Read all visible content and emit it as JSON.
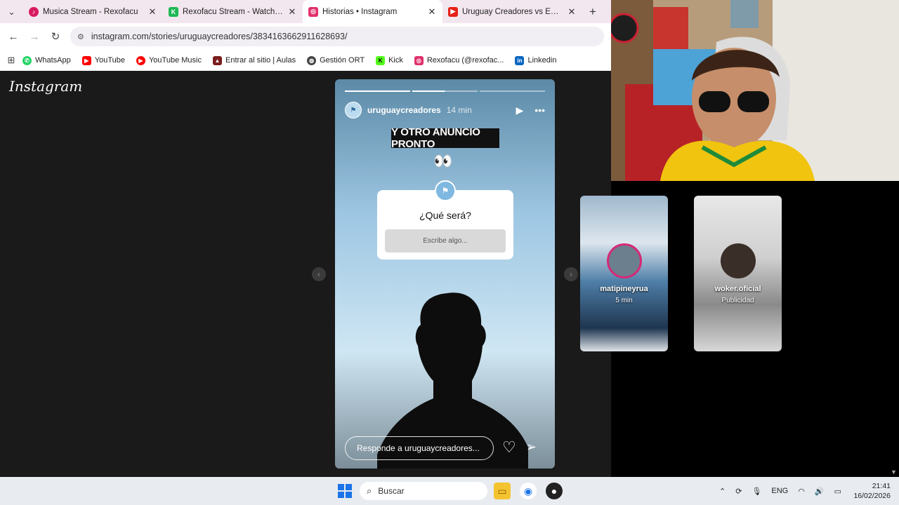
{
  "browser": {
    "tabs": [
      {
        "title": "Musica Stream - Rexofacu",
        "favicon_color": "#d81b60",
        "icon": "music-icon"
      },
      {
        "title": "Rexofacu Stream - Watch Live on Kick",
        "favicon_color": "#1db954",
        "icon": "kick-icon"
      },
      {
        "title": "Historias • Instagram",
        "favicon_color": "#e1306c",
        "icon": "instagram-icon",
        "active": true
      },
      {
        "title": "Uruguay Creadores vs Ex jugadores",
        "favicon_color": "#e62117",
        "icon": "youtube-icon"
      }
    ],
    "url": "instagram.com/stories/uruguaycreadores/3834163662911628693/",
    "bookmarks": [
      {
        "label": "WhatsApp",
        "color": "#25d366"
      },
      {
        "label": "YouTube",
        "color": "#ff0000"
      },
      {
        "label": "YouTube Music",
        "color": "#ff0000"
      },
      {
        "label": "Entrar al sitio | Aulas",
        "color": "#7a1e1e"
      },
      {
        "label": "Gestión ORT",
        "color": "#444444"
      },
      {
        "label": "Kick",
        "color": "#53fc18"
      },
      {
        "label": "Rexofacu (@rexofac...",
        "color": "#e1306c"
      },
      {
        "label": "Linkedin",
        "color": "#0a66c2"
      }
    ]
  },
  "instagram": {
    "logo": "Instagram",
    "story": {
      "username": "uruguaycreadores",
      "time": "14 min",
      "banner_text": "Y OTRO ANUNCIO PRONTO",
      "eyes_emoji": "👀",
      "question": "¿Qué será?",
      "question_placeholder": "Escribe algo...",
      "reply_placeholder": "Responde a uruguaycreadores..."
    },
    "next_previews": [
      {
        "name": "matipineyrua",
        "subtitle": "5 min"
      },
      {
        "name": "woker.oficial",
        "subtitle": "Publicidad"
      }
    ]
  },
  "taskbar": {
    "search_label": "Buscar",
    "language": "ENG",
    "time": "21:41",
    "date": "16/02/2026"
  }
}
